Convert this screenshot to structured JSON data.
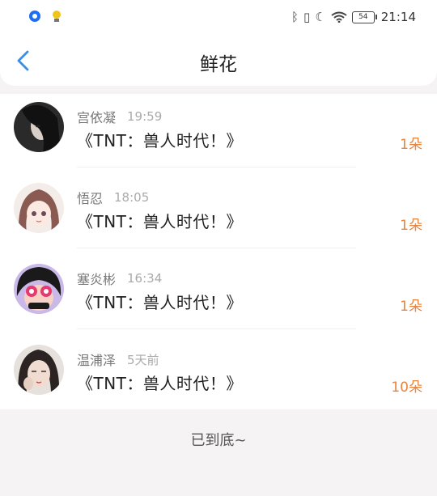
{
  "status_bar": {
    "battery": "54",
    "time": "21:14"
  },
  "header": {
    "title": "鲜花"
  },
  "items": [
    {
      "name": "宫依凝",
      "time": "19:59",
      "title": "《TNT：兽人时代！》",
      "count": "1朵"
    },
    {
      "name": "悟忍",
      "time": "18:05",
      "title": "《TNT：兽人时代！》",
      "count": "1朵"
    },
    {
      "name": "塞炎彬",
      "time": "16:34",
      "title": "《TNT：兽人时代！》",
      "count": "1朵"
    },
    {
      "name": "温浦泽",
      "time": "5天前",
      "title": "《TNT：兽人时代！》",
      "count": "10朵"
    }
  ],
  "footer": {
    "end_text": "已到底~"
  },
  "colors": {
    "accent": "#e8843e",
    "back_arrow": "#3a8ee6"
  }
}
